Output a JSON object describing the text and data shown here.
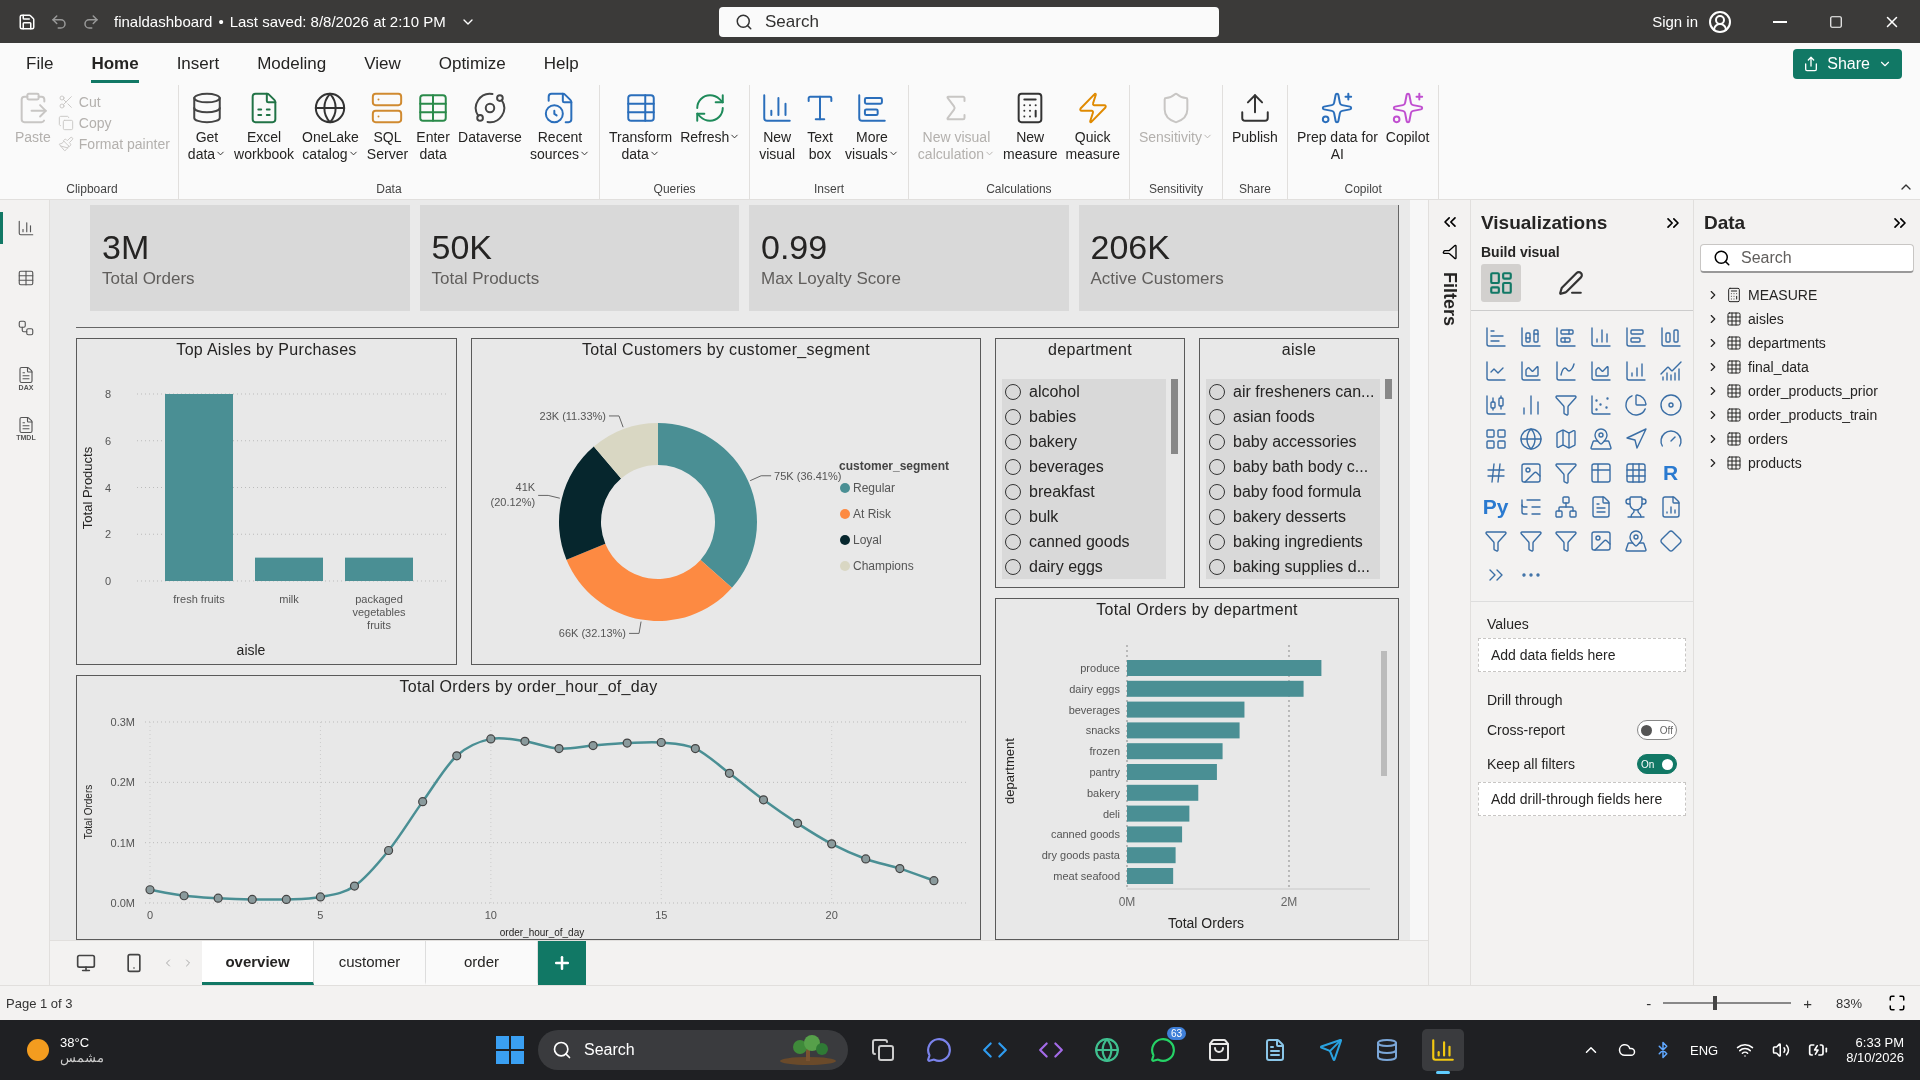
{
  "window": {
    "file_name": "finaldashboard",
    "separator": "•",
    "saved": "Last saved: 8/8/2026 at 2:10 PM",
    "search_placeholder": "Search",
    "sign_in": "Sign in"
  },
  "menu_tabs": [
    {
      "label": "File",
      "selected": false
    },
    {
      "label": "Home",
      "selected": true
    },
    {
      "label": "Insert",
      "selected": false
    },
    {
      "label": "Modeling",
      "selected": false
    },
    {
      "label": "View",
      "selected": false
    },
    {
      "label": "Optimize",
      "selected": false
    },
    {
      "label": "Help",
      "selected": false
    }
  ],
  "share": "Share",
  "ribbon": [
    {
      "name": "Clipboard",
      "items": [
        {
          "kind": "large",
          "label": "Paste",
          "disabled": true,
          "dropdown": false
        },
        {
          "kind": "small",
          "label": "Cut",
          "disabled": true,
          "dropdown": false
        },
        {
          "kind": "small",
          "label": "Copy",
          "disabled": true,
          "dropdown": false
        },
        {
          "kind": "small",
          "label": "Format painter",
          "disabled": true,
          "dropdown": false
        }
      ]
    },
    {
      "name": "Data",
      "items": [
        {
          "kind": "large",
          "label": "Get\ndata",
          "disabled": false,
          "dropdown": true
        },
        {
          "kind": "large",
          "label": "Excel\nworkbook",
          "disabled": false,
          "dropdown": false
        },
        {
          "kind": "large",
          "label": "OneLake\ncatalog",
          "disabled": false,
          "dropdown": true
        },
        {
          "kind": "large",
          "label": "SQL\nServer",
          "disabled": false,
          "dropdown": false
        },
        {
          "kind": "large",
          "label": "Enter\ndata",
          "disabled": false,
          "dropdown": false
        },
        {
          "kind": "large",
          "label": "Dataverse",
          "disabled": false,
          "dropdown": false
        },
        {
          "kind": "large",
          "label": "Recent\nsources",
          "disabled": false,
          "dropdown": true
        }
      ]
    },
    {
      "name": "Queries",
      "items": [
        {
          "kind": "large",
          "label": "Transform\ndata",
          "disabled": false,
          "dropdown": true
        },
        {
          "kind": "large",
          "label": "Refresh",
          "disabled": false,
          "dropdown": true
        }
      ]
    },
    {
      "name": "Insert",
      "items": [
        {
          "kind": "large",
          "label": "New\nvisual",
          "disabled": false,
          "dropdown": false
        },
        {
          "kind": "large",
          "label": "Text\nbox",
          "disabled": false,
          "dropdown": false
        },
        {
          "kind": "large",
          "label": "More\nvisuals",
          "disabled": false,
          "dropdown": true
        }
      ]
    },
    {
      "name": "Calculations",
      "items": [
        {
          "kind": "large",
          "label": "New visual\ncalculation",
          "disabled": true,
          "dropdown": true
        },
        {
          "kind": "large",
          "label": "New\nmeasure",
          "disabled": false,
          "dropdown": false
        },
        {
          "kind": "large",
          "label": "Quick\nmeasure",
          "disabled": false,
          "dropdown": false
        }
      ]
    },
    {
      "name": "Sensitivity",
      "items": [
        {
          "kind": "large",
          "label": "Sensitivity",
          "disabled": true,
          "dropdown": true
        }
      ]
    },
    {
      "name": "Share",
      "items": [
        {
          "kind": "large",
          "label": "Publish",
          "disabled": false,
          "dropdown": false
        }
      ]
    },
    {
      "name": "Copilot",
      "items": [
        {
          "kind": "large",
          "label": "Prep data for\nAI",
          "disabled": false,
          "dropdown": false
        },
        {
          "kind": "large",
          "label": "Copilot",
          "disabled": false,
          "dropdown": false
        }
      ]
    }
  ],
  "nav": [
    {
      "kind": "report",
      "selected": true
    },
    {
      "kind": "table",
      "selected": false
    },
    {
      "kind": "model",
      "selected": false
    },
    {
      "kind": "dax",
      "label": "DAX",
      "selected": false
    },
    {
      "kind": "tmdl",
      "label": "TMDL",
      "selected": false
    }
  ],
  "kpis": [
    {
      "value": "3M",
      "label": "Total Orders"
    },
    {
      "value": "50K",
      "label": "Total Products"
    },
    {
      "value": "0.99",
      "label": "Max Loyalty Score"
    },
    {
      "value": "206K",
      "label": "Active Customers"
    }
  ],
  "top_aisles": {
    "chart_data": {
      "type": "bar",
      "title": "Top Aisles by Purchases",
      "xlabel": "aisle",
      "grid": true,
      "categories": [
        "fresh fruits",
        "milk",
        "packaged vegetables fruits"
      ],
      "series": [
        {
          "name": "Total Products",
          "color": "#4a8f94",
          "values": [
            8,
            1,
            1
          ]
        }
      ],
      "ylim": [
        0,
        8
      ],
      "yticks": [
        0,
        2,
        4,
        6,
        8
      ]
    }
  },
  "segments": {
    "chart_data": {
      "type": "donut",
      "legend": {
        "title": "customer_segment"
      },
      "title": "Total Customers by customer_segment",
      "categories": [
        "Regular",
        "At Risk",
        "Loyal",
        "Champions"
      ],
      "values": [
        75000,
        66000,
        41000,
        23000
      ],
      "colors": [
        "#4a8f94",
        "#fd8a42",
        "#06262d",
        "#d9d7c3"
      ],
      "value_labels": [
        "75K (36.41%)",
        "66K (32.13%)",
        "41K (20.12%)",
        "23K (11.33%)"
      ]
    }
  },
  "hourly": {
    "chart_data": {
      "type": "line",
      "title": "Total Orders by order_hour_of_day",
      "xlabel": "order_hour_of_day",
      "grid": true,
      "x": [
        0,
        1,
        2,
        3,
        4,
        5,
        6,
        7,
        8,
        9,
        10,
        11,
        12,
        13,
        14,
        15,
        16,
        17,
        18,
        19,
        20,
        21,
        22,
        23
      ],
      "series": [
        {
          "name": "Total Orders",
          "color": "#4a8f94",
          "marker": "circle",
          "values": [
            22000,
            12000,
            8000,
            6000,
            6000,
            10000,
            28000,
            87000,
            168000,
            244000,
            272000,
            268000,
            256000,
            261000,
            265000,
            266000,
            256000,
            215000,
            171000,
            132000,
            98000,
            73000,
            57000,
            37000
          ]
        }
      ],
      "xlim": [
        0,
        24
      ],
      "ylim": [
        0,
        300000
      ],
      "xticks": [
        0,
        5,
        10,
        15,
        20
      ],
      "yticks": [
        {
          "value": 0,
          "label": "0.0M"
        },
        {
          "value": 100000,
          "label": "0.1M"
        },
        {
          "value": 200000,
          "label": "0.2M"
        },
        {
          "value": 300000,
          "label": "0.3M"
        }
      ]
    }
  },
  "slicers": [
    {
      "title": "department",
      "items": [
        {
          "label": "alcohol",
          "selected": false
        },
        {
          "label": "babies",
          "selected": false
        },
        {
          "label": "bakery",
          "selected": false
        },
        {
          "label": "beverages",
          "selected": false
        },
        {
          "label": "breakfast",
          "selected": false
        },
        {
          "label": "bulk",
          "selected": false
        },
        {
          "label": "canned goods",
          "selected": false
        },
        {
          "label": "dairy eggs",
          "selected": false
        }
      ]
    },
    {
      "title": "aisle",
      "items": [
        {
          "label": "air fresheners can...",
          "selected": false
        },
        {
          "label": "asian foods",
          "selected": false
        },
        {
          "label": "baby accessories",
          "selected": false
        },
        {
          "label": "baby bath body c...",
          "selected": false
        },
        {
          "label": "baby food formula",
          "selected": false
        },
        {
          "label": "bakery desserts",
          "selected": false
        },
        {
          "label": "baking ingredients",
          "selected": false
        },
        {
          "label": "baking supplies d...",
          "selected": false
        }
      ]
    }
  ],
  "dept_orders": {
    "chart_data": {
      "type": "bar",
      "orientation": "horizontal",
      "title": "Total Orders by department",
      "ylabel": "department",
      "grid": true,
      "xlim": [
        0,
        3000000
      ],
      "categories": [
        "produce",
        "dairy eggs",
        "beverages",
        "snacks",
        "frozen",
        "pantry",
        "bakery",
        "deli",
        "canned goods",
        "dry goods pasta",
        "meat seafood"
      ],
      "series": [
        {
          "name": "Total Orders",
          "color": "#4a8f94",
          "values": [
            2400000,
            2180000,
            1450000,
            1390000,
            1180000,
            1110000,
            880000,
            770000,
            680000,
            600000,
            570000
          ]
        }
      ],
      "xticks": [
        {
          "value": 0,
          "label": "0M"
        },
        {
          "value": 2000000,
          "label": "2M"
        }
      ]
    }
  },
  "pages": [
    {
      "label": "overview",
      "selected": true
    },
    {
      "label": "customer",
      "selected": false
    },
    {
      "label": "order",
      "selected": false
    }
  ],
  "filters": {
    "label": "Filters"
  },
  "viz": {
    "title": "Visualizations",
    "build_visual": "Build visual",
    "build_modes": [
      {
        "kind": "build",
        "selected": true
      },
      {
        "kind": "format",
        "selected": false
      }
    ],
    "glyph_visuals": [
      "R",
      "Py"
    ],
    "values_label": "Values",
    "values_placeholder": "Add data fields here",
    "drill_title": "Drill through",
    "toggles": [
      {
        "label": "Cross-report",
        "on": false,
        "state_text": "Off"
      },
      {
        "label": "Keep all filters",
        "on": true,
        "state_text": "On"
      }
    ],
    "drill_placeholder": "Add drill-through fields here"
  },
  "data_pane": {
    "title": "Data",
    "search_placeholder": "Search",
    "tables": [
      {
        "kind": "measure",
        "label": "MEASURE",
        "expanded": false
      },
      {
        "kind": "table",
        "label": "aisles",
        "expanded": false
      },
      {
        "kind": "table",
        "label": "departments",
        "expanded": false
      },
      {
        "kind": "table",
        "label": "final_data",
        "expanded": false
      },
      {
        "kind": "table",
        "label": "order_products_prior",
        "expanded": false
      },
      {
        "kind": "table",
        "label": "order_products_train",
        "expanded": false
      },
      {
        "kind": "table",
        "label": "orders",
        "expanded": false
      },
      {
        "kind": "table",
        "label": "products",
        "expanded": false
      }
    ]
  },
  "status": {
    "page_info": "Page 1 of 3",
    "zoom_out": "-",
    "zoom_in": "+",
    "level": 0.39,
    "zoom": "83%"
  },
  "taskbar": {
    "temp": "38°C",
    "condition": "مشمس",
    "search_placeholder": "Search",
    "badge": "63",
    "language": "ENG",
    "time": "6:33 PM",
    "date": "8/10/2026"
  }
}
